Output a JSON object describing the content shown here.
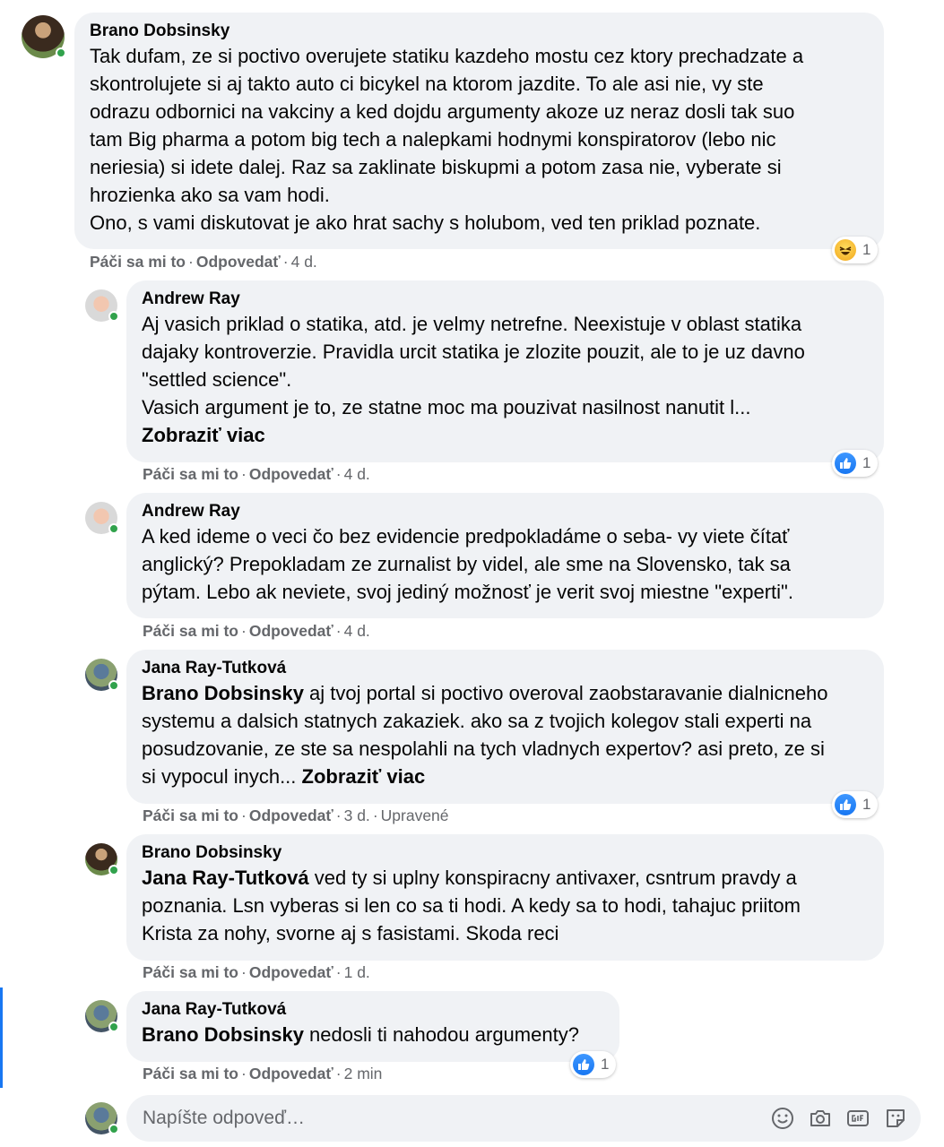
{
  "colors": {
    "bubble": "#f0f2f5",
    "meta_text": "#65676b",
    "online": "#31a24c",
    "like_blue": "#1877f2",
    "accent_bar": "#1877f2"
  },
  "labels": {
    "like": "Páči sa mi to",
    "reply": "Odpovedať",
    "dot": "·",
    "edited": "Upravené",
    "see_more": "Zobraziť viac"
  },
  "comments": [
    {
      "author": "Brano Dobsinsky",
      "text": "Tak dufam, ze si poctivo overujete statiku kazdeho mostu cez ktory prechadzate a\nskontrolujete si aj takto auto ci bicykel na ktorom jazdite. To ale asi nie, vy ste\nodrazu odbornici na vakciny a ked dojdu argumenty akoze uz neraz dosli tak suo\ntam Big pharma a potom big tech a nalepkami hodnymi konspiratorov (lebo nic\nneriesia) si idete dalej. Raz sa zaklinate biskupmi a potom zasa nie, vyberate si\nhrozienka ako sa vam hodi.\nOno, s vami diskutovat je ako hrat sachy s holubom, ved ten priklad poznate.",
      "time": "4 d.",
      "reaction": {
        "icon": "haha-icon",
        "count": "1"
      }
    },
    {
      "author": "Andrew Ray",
      "text": "Aj vasich priklad o statika, atd. je velmy netrefne. Neexistuje v oblast statika\ndajaky kontroverzie. Pravidla urcit statika je zlozite pouzit, ale to je uz davno\n\"settled science\".\nVasich argument je to, ze statne moc ma pouzivat nasilnost nanutit l...",
      "time": "4 d.",
      "reaction": {
        "icon": "like-icon",
        "count": "1"
      }
    },
    {
      "author": "Andrew Ray",
      "text": "A ked ideme o veci čo bez evidencie predpokladáme o seba- vy viete čítať\nanglický? Prepokladam ze zurnalist by videl, ale sme na Slovensko, tak sa\npýtam. Lebo ak neviete, svoj jediný možnosť je verit svoj miestne \"experti\".",
      "time": "4 d."
    },
    {
      "author": "Jana Ray-Tutková",
      "mention": "Brano Dobsinsky",
      "text": " aj tvoj portal si poctivo overoval zaobstaravanie dialnicneho\nsystemu a dalsich statnych zakaziek. ako sa z tvojich kolegov stali experti na\nposudzovanie, ze ste sa nespolahli na tych vladnych expertov? asi preto, ze si\nsi vypocul inych... ",
      "time": "3 d.",
      "reaction": {
        "icon": "like-icon",
        "count": "1"
      }
    },
    {
      "author": "Brano Dobsinsky",
      "mention": "Jana Ray-Tutková",
      "text": " ved ty si uplny konspiracny antivaxer, csntrum pravdy a\npoznania. Lsn vyberas si len co sa ti hodi. A kedy sa to hodi, tahajuc priitom\nKrista za nohy, svorne aj s fasistami. Skoda reci",
      "time": "1 d."
    },
    {
      "author": "Jana Ray-Tutková",
      "mention": "Brano Dobsinsky",
      "text": " nedosli ti nahodou argumenty?",
      "time": "2 min",
      "reaction": {
        "icon": "like-icon",
        "count": "1"
      }
    }
  ],
  "composer": {
    "placeholder": "Napíšte odpoveď…",
    "tools": [
      "emoji-icon",
      "camera-icon",
      "gif-icon",
      "sticker-icon"
    ]
  }
}
